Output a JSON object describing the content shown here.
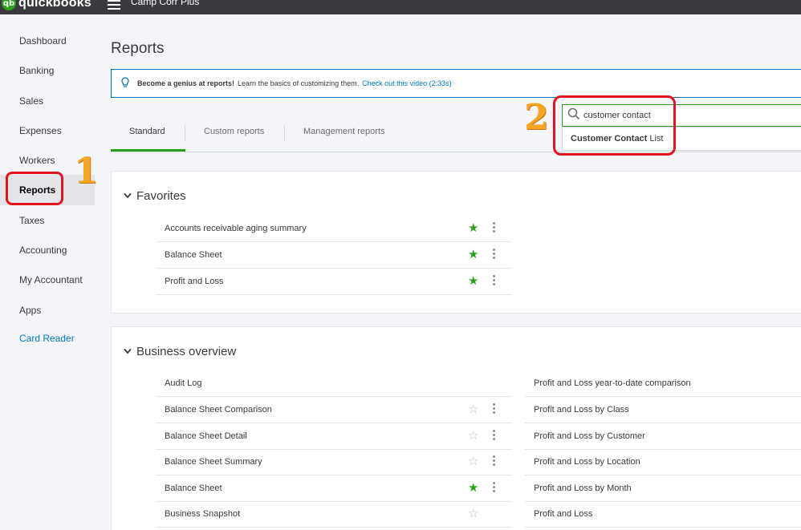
{
  "app": {
    "logo_mark": "qb",
    "logo_text": "quickbooks",
    "company": "Camp Corr Plus"
  },
  "sidebar": {
    "items": [
      {
        "label": "Dashboard"
      },
      {
        "label": "Banking"
      },
      {
        "label": "Sales"
      },
      {
        "label": "Expenses"
      },
      {
        "label": "Workers"
      },
      {
        "label": "Reports"
      },
      {
        "label": "Taxes"
      },
      {
        "label": "Accounting"
      },
      {
        "label": "My Accountant"
      },
      {
        "label": "Apps"
      },
      {
        "label": "Card Reader"
      }
    ],
    "active": "Reports"
  },
  "annotations": {
    "one": "1",
    "two": "2",
    "box_color": "#e5131d",
    "number_color": "#f5a623"
  },
  "page": {
    "title": "Reports"
  },
  "banner": {
    "icon": "lightbulb-icon",
    "bold": "Become a genius at reports!",
    "text": "Learn the basics of customizing them.",
    "link": "Check out this video (2:33s)"
  },
  "tabs": [
    {
      "label": "Standard",
      "active": true
    },
    {
      "label": "Custom reports"
    },
    {
      "label": "Management reports"
    }
  ],
  "search": {
    "icon": "search-icon",
    "value": "customer contact",
    "suggestion_bold": "Customer Contact",
    "suggestion_rest": "List"
  },
  "favorites": {
    "title": "Favorites",
    "rows": [
      {
        "label": "Accounts receivable aging summary",
        "starred": true
      },
      {
        "label": "Balance Sheet",
        "starred": true
      },
      {
        "label": "Profit and Loss",
        "starred": true
      }
    ]
  },
  "business_overview": {
    "title": "Business overview",
    "left": [
      {
        "label": "Audit Log"
      },
      {
        "label": "Balance Sheet Comparison",
        "starred": false
      },
      {
        "label": "Balance Sheet Detail",
        "starred": false
      },
      {
        "label": "Balance Sheet Summary",
        "starred": false
      },
      {
        "label": "Balance Sheet",
        "starred": true
      },
      {
        "label": "Business Snapshot",
        "starred": false
      }
    ],
    "right": [
      {
        "label": "Profit and Loss year-to-date comparison"
      },
      {
        "label": "Profit and Loss by Class"
      },
      {
        "label": "Profit and Loss by Customer"
      },
      {
        "label": "Profit and Loss by Location"
      },
      {
        "label": "Profit and Loss by Month"
      },
      {
        "label": "Profit and Loss"
      }
    ]
  },
  "colors": {
    "brand_green": "#2ca01c",
    "link_blue": "#0077c5",
    "topbar": "#393a3d"
  }
}
